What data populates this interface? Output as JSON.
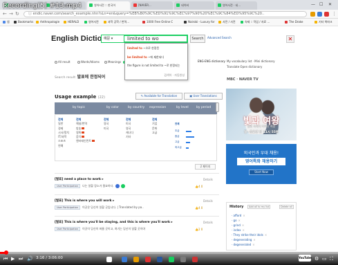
{
  "video": {
    "title": "Recording(5) #13.mp4",
    "time": "3:16 / 3:06:00",
    "progress": 0.018,
    "logo": "YouTube"
  },
  "browser": {
    "tabs": [
      "네이버 영어사전",
      "영어사전 - 네이버",
      "영어사전 :: 한국어",
      "[NAVER...",
      "네이버",
      "영어사전 · 네..."
    ],
    "url": "endic.naver.com/search_example.nhn?sLn=en&query=%EB%B0%9C%ED%91%9C%EC%97%90%20%EC%9C%84%ED%95%9C%20..",
    "bookmarks": [
      "앱",
      "Bookmarks",
      "Anthropologie",
      "HERALD",
      "영어사전",
      "과학 공학 / 번역...",
      "1000 Free Online C",
      "Nairobi - Luxury for",
      "사전 / 사전",
      "숙제 :: 작업 / 자료 ...",
      "The Drake"
    ],
    "other_bookmarks": "기타 북마크"
  },
  "dictionary": {
    "logo": "English Dictionary",
    "lang_select": "예문 ▾",
    "search_value": "limited to wo",
    "search_button": "Search",
    "advanced_search": "Advanced Search",
    "autocomplete": [
      {
        "kw": "limited to",
        "rest": " ~으로 한정된"
      },
      {
        "kw": "be limited to",
        "rest": " ~에 제한되다"
      },
      {
        "kw": "",
        "rest": "the figure is not limited to ~로 한정되는"
      }
    ],
    "autocomplete_footer": "검색어 · 자동완성",
    "filters": [
      "All result",
      "Words/Idioms",
      "Meanings",
      "Examples"
    ],
    "eng_dict_label": "ENG-ENG dictionary",
    "vocab_list": "My vocabulary list  ·  Mini dictionary",
    "translate": "Translate  Open dictionary",
    "result_prefix": "Search result:",
    "result_query": "발표에 한정되어",
    "result_suffix": ""
  },
  "usage": {
    "title": "Usage example",
    "count": "(22)",
    "available_btn": "Available for Translation",
    "user_btn": "User Translations",
    "filter_headers": [
      "by topic",
      "by color",
      "by country",
      "expression",
      "by level",
      "by period"
    ],
    "columns": [
      [
        "전체",
        "일반",
        "경제",
        "시사/정치",
        "IT/과학",
        "스포츠",
        "연예"
      ],
      [
        "전체",
        "해설/번역",
        "방송",
        "영화",
        "음악",
        "엔터테인먼트"
      ],
      [
        "전체",
        "영국",
        "미국"
      ],
      [
        "전체",
        "미국",
        "영국",
        "캐나다",
        "기타"
      ],
      [
        "전체",
        "기업",
        "문화",
        "고급"
      ]
    ],
    "levels": [
      "전체",
      "초급",
      "중급",
      "고급",
      "최고급"
    ],
    "prev_next": "2 페이지",
    "sentences": [
      {
        "text": "[발표] need a place to work",
        "tag": "User Participation",
        "sub": "나는 일할 장소가 필요하다.",
        "details": "Details",
        "likes": "4  0"
      },
      {
        "text": "[발표] This is where you will work",
        "tag": "User Participation",
        "sub": "이곳은 당신이 일할 곳입니다. | Translated by pa..",
        "details": "Details",
        "likes": "4  0"
      },
      {
        "text": "[발표] This is where you'll be staying, and this is where you'll work",
        "tag": "User Participation",
        "sub": "이곳이 당신이 머물 곳이고, 여기는 당신이 일할 곳이야",
        "details": "Details",
        "likes": "2  0"
      }
    ]
  },
  "sidebar": {
    "brand": "MBC · NAVER TV",
    "ad_title": "빛과 여왕",
    "ad_sub1": "절망 속에서 피어난 희망",
    "ad_sub2": "월~금요일 밤 11시 55분",
    "job_l1": "외국인과 우대 채용!",
    "job_l2": "영어특화 채용하기",
    "job_btn": "Start Now",
    "history_title": "History",
    "history_add": "Add all to my list",
    "history_del": "Delete all",
    "history_items": [
      "afford",
      "go",
      "grind",
      "index",
      "They strike their idols",
      "degenerating",
      "degenerated"
    ]
  },
  "colors": {
    "naver_green": "#19ce60",
    "link_blue": "#1a57a8",
    "progress_red": "#ff0000"
  }
}
